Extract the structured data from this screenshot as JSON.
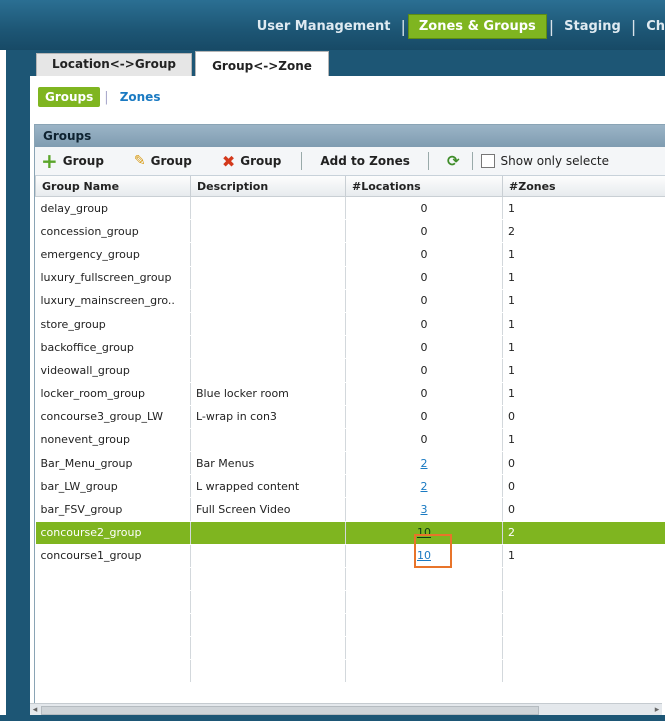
{
  "topnav": {
    "items": [
      "User Management",
      "Zones & Groups",
      "Staging",
      "Ch"
    ],
    "active_index": 1
  },
  "tabs": {
    "location_group": "Location<->Group",
    "group_zone": "Group<->Zone",
    "active": "group_zone"
  },
  "subtabs": {
    "groups": "Groups",
    "zones": "Zones",
    "active": "groups"
  },
  "panel": {
    "title": "Groups"
  },
  "toolbar": {
    "add_group": "Group",
    "edit_group": "Group",
    "delete_group": "Group",
    "add_to_zones": "Add to Zones",
    "show_only_selected": "Show only selecte"
  },
  "table": {
    "columns": [
      "Group Name",
      "Description",
      "#Locations",
      "#Zones"
    ],
    "rows": [
      {
        "name": "delay_group",
        "description": "",
        "locations": "0",
        "zones": "1",
        "link": false
      },
      {
        "name": "concession_group",
        "description": "",
        "locations": "0",
        "zones": "2",
        "link": false
      },
      {
        "name": "emergency_group",
        "description": "",
        "locations": "0",
        "zones": "1",
        "link": false
      },
      {
        "name": "luxury_fullscreen_group",
        "description": "",
        "locations": "0",
        "zones": "1",
        "link": false
      },
      {
        "name": "luxury_mainscreen_gro..",
        "description": "",
        "locations": "0",
        "zones": "1",
        "link": false
      },
      {
        "name": "store_group",
        "description": "",
        "locations": "0",
        "zones": "1",
        "link": false
      },
      {
        "name": "backoffice_group",
        "description": "",
        "locations": "0",
        "zones": "1",
        "link": false
      },
      {
        "name": "videowall_group",
        "description": "",
        "locations": "0",
        "zones": "1",
        "link": false
      },
      {
        "name": "locker_room_group",
        "description": "Blue locker room",
        "locations": "0",
        "zones": "1",
        "link": false
      },
      {
        "name": "concourse3_group_LW",
        "description": "L-wrap in con3",
        "locations": "0",
        "zones": "0",
        "link": false
      },
      {
        "name": "nonevent_group",
        "description": "",
        "locations": "0",
        "zones": "1",
        "link": false
      },
      {
        "name": "Bar_Menu_group",
        "description": "Bar Menus",
        "locations": "2",
        "zones": "0",
        "link": true
      },
      {
        "name": "bar_LW_group",
        "description": "L wrapped content",
        "locations": "2",
        "zones": "0",
        "link": true
      },
      {
        "name": "bar_FSV_group",
        "description": "Full Screen Video",
        "locations": "3",
        "zones": "0",
        "link": true
      },
      {
        "name": "concourse2_group",
        "description": "",
        "locations": "10",
        "zones": "2",
        "link": true,
        "selected": true
      },
      {
        "name": "concourse1_group",
        "description": "",
        "locations": "10",
        "zones": "1",
        "link": true
      }
    ]
  },
  "colors": {
    "accent_green": "#7fb520",
    "header_blue": "#1d5675",
    "link_blue": "#1a7ac2",
    "highlight_orange": "#e8742a"
  }
}
